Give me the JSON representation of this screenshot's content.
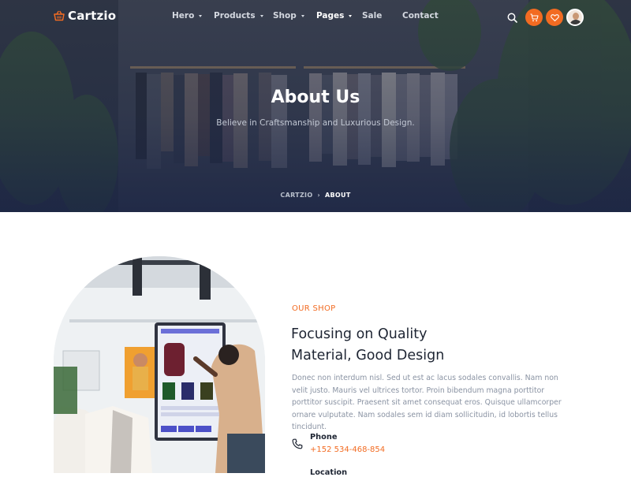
{
  "brand": {
    "name": "Cartzio",
    "accent": "#f26b22"
  },
  "nav": {
    "items": [
      {
        "label": "Hero",
        "has_dropdown": true
      },
      {
        "label": "Products",
        "has_dropdown": true
      },
      {
        "label": "Shop",
        "has_dropdown": true
      },
      {
        "label": "Pages",
        "has_dropdown": true,
        "active": true
      },
      {
        "label": "Sale",
        "has_dropdown": false
      },
      {
        "label": "Contact",
        "has_dropdown": false
      }
    ],
    "actions": [
      "search-icon",
      "cart-icon",
      "heart-icon",
      "avatar"
    ]
  },
  "hero": {
    "title": "About Us",
    "subtitle": "Believe in Craftsmanship and Luxurious Design.",
    "breadcrumb": {
      "home": "CARTZIO",
      "current": "ABOUT"
    }
  },
  "about": {
    "eyebrow": "OUR SHOP",
    "heading_line1": "Focusing on Quality",
    "heading_line2": "Material, Good Design",
    "paragraph": "Donec non interdum nisl. Sed ut est ac lacus sodales convallis. Nam non velit justo. Mauris vel ultrices tortor. Proin bibendum magna porttitor porttitor suscipit. Praesent sit amet consequat eros. Quisque ullamcorper ornare vulputate. Nam sodales sem id diam sollicitudin, id lobortis tellus tincidunt.",
    "contacts": [
      {
        "label": "Phone",
        "value": "+152 534-468-854",
        "icon": "phone-icon"
      },
      {
        "label": "Location",
        "icon": "location-icon"
      }
    ]
  }
}
